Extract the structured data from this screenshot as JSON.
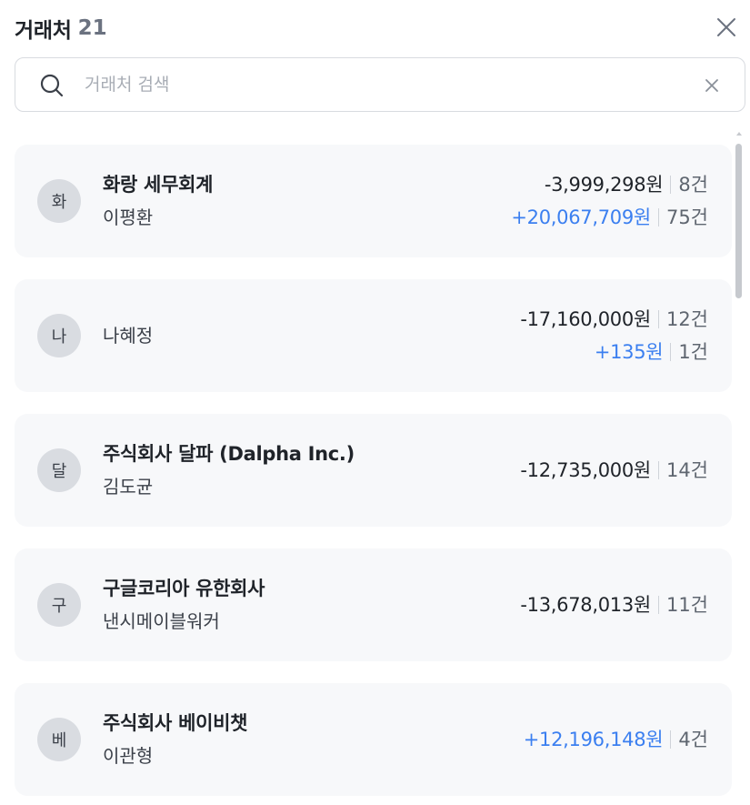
{
  "header": {
    "title": "거래처",
    "count": "21"
  },
  "search": {
    "placeholder": "거래처 검색",
    "value": ""
  },
  "icons": {
    "close": "close-icon",
    "search": "search-icon",
    "clear": "clear-icon"
  },
  "colors": {
    "accent": "#3b7ff0",
    "card_bg": "#f7f8fa",
    "avatar_bg": "#d9dce1"
  },
  "clients": [
    {
      "avatar": "화",
      "name": "화랑 세무회계",
      "rep": "이평환",
      "rows": [
        {
          "amount": "-3,999,298원",
          "count": "8건",
          "positive": false
        },
        {
          "amount": "+20,067,709원",
          "count": "75건",
          "positive": true
        }
      ]
    },
    {
      "avatar": "나",
      "name": "",
      "rep": "나혜정",
      "rows": [
        {
          "amount": "-17,160,000원",
          "count": "12건",
          "positive": false
        },
        {
          "amount": "+135원",
          "count": "1건",
          "positive": true
        }
      ]
    },
    {
      "avatar": "달",
      "name": "주식회사 달파 (Dalpha Inc.)",
      "rep": "김도균",
      "rows": [
        {
          "amount": "-12,735,000원",
          "count": "14건",
          "positive": false
        }
      ]
    },
    {
      "avatar": "구",
      "name": "구글코리아 유한회사",
      "rep": "낸시메이블워커",
      "rows": [
        {
          "amount": "-13,678,013원",
          "count": "11건",
          "positive": false
        }
      ]
    },
    {
      "avatar": "베",
      "name": "주식회사 베이비챗",
      "rep": "이관형",
      "rows": [
        {
          "amount": "+12,196,148원",
          "count": "4건",
          "positive": true
        }
      ]
    }
  ]
}
